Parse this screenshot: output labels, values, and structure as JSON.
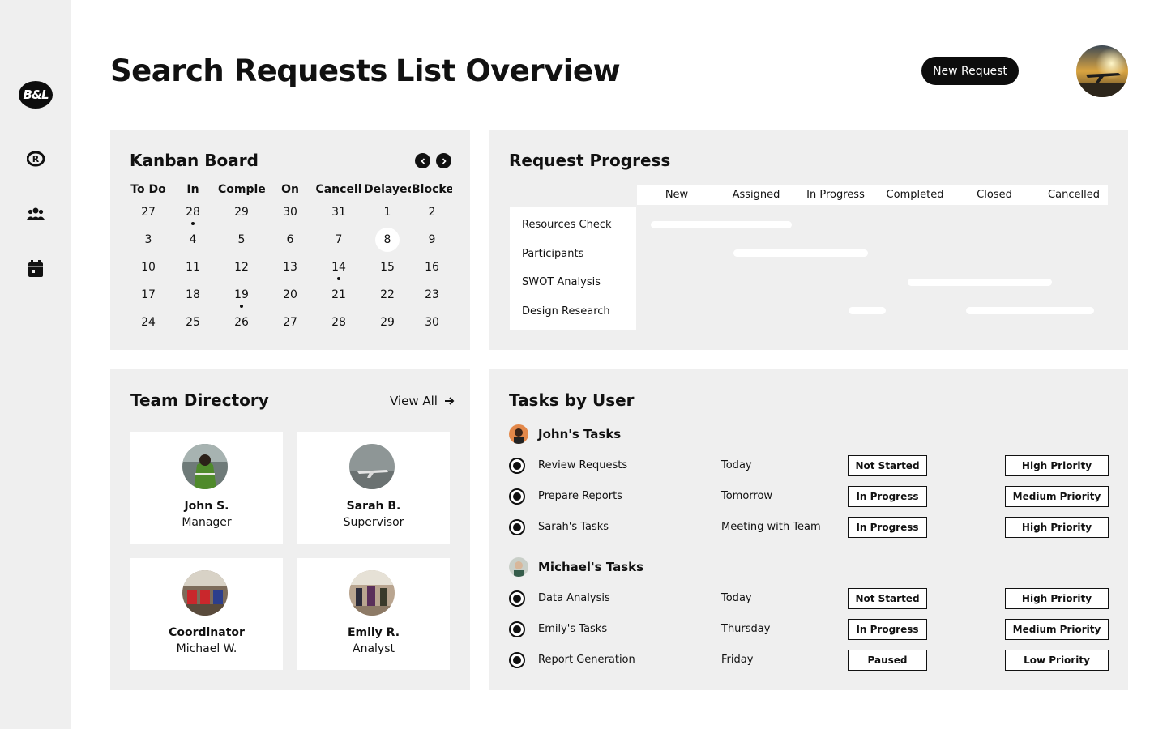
{
  "sidebar": {
    "logo_text": "B&L",
    "icons": [
      "registered-icon",
      "users-icon",
      "calendar-icon"
    ]
  },
  "header": {
    "title_part1": "Search Requests",
    "title_part2": "List Overview",
    "new_request_label": "New Request"
  },
  "kanban": {
    "title": "Kanban Board",
    "columns": [
      "To Do",
      "In",
      "Comple",
      "On",
      "Cancell",
      "Delayec",
      "Blocke"
    ],
    "weeks": [
      [
        "27",
        "28",
        "29",
        "30",
        "31",
        "1",
        "2"
      ],
      [
        "3",
        "4",
        "5",
        "6",
        "7",
        "8",
        "9"
      ],
      [
        "10",
        "11",
        "12",
        "13",
        "14",
        "15",
        "16"
      ],
      [
        "17",
        "18",
        "19",
        "20",
        "21",
        "22",
        "23"
      ],
      [
        "24",
        "25",
        "26",
        "27",
        "28",
        "29",
        "30"
      ]
    ],
    "selected": "8"
  },
  "progress": {
    "title": "Request Progress",
    "columns": [
      "New",
      "Assigned",
      "In Progress",
      "Completed",
      "Closed",
      "Cancelled"
    ],
    "rows": [
      "Resources Check",
      "Participants",
      "SWOT Analysis",
      "Design Research"
    ]
  },
  "team": {
    "title": "Team Directory",
    "view_all": "View All",
    "members": [
      {
        "line1": "John S.",
        "line2": "Manager"
      },
      {
        "line1": "Sarah B.",
        "line2": "Supervisor"
      },
      {
        "line1": "Coordinator",
        "line2": "Michael W."
      },
      {
        "line1": "Emily R.",
        "line2": "Analyst"
      }
    ]
  },
  "tasks": {
    "title": "Tasks by User",
    "groups": [
      {
        "user": "John's Tasks",
        "items": [
          {
            "name": "Review Requests",
            "date": "Today",
            "status": "Not Started",
            "priority": "High Priority"
          },
          {
            "name": "Prepare Reports",
            "date": "Tomorrow",
            "status": "In Progress",
            "priority": "Medium Priority"
          },
          {
            "name": "Sarah's Tasks",
            "date": "Meeting with Team",
            "status": "In Progress",
            "priority": "High Priority"
          }
        ]
      },
      {
        "user": "Michael's Tasks",
        "items": [
          {
            "name": "Data Analysis",
            "date": "Today",
            "status": "Not Started",
            "priority": "High Priority"
          },
          {
            "name": "Emily's Tasks",
            "date": "Thursday",
            "status": "In Progress",
            "priority": "Medium Priority"
          },
          {
            "name": "Report Generation",
            "date": "Friday",
            "status": "Paused",
            "priority": "Low Priority"
          }
        ]
      }
    ]
  }
}
